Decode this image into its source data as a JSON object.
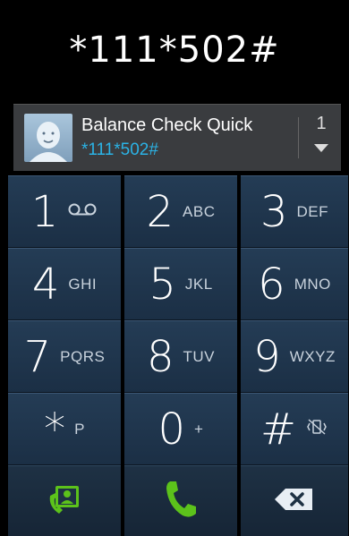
{
  "display": {
    "number": "*111*502#"
  },
  "suggestion": {
    "name": "Balance Check Quick",
    "number": "*111*502#",
    "count": "1"
  },
  "keys": [
    {
      "digit": "1",
      "letters": ""
    },
    {
      "digit": "2",
      "letters": "ABC"
    },
    {
      "digit": "3",
      "letters": "DEF"
    },
    {
      "digit": "4",
      "letters": "GHI"
    },
    {
      "digit": "5",
      "letters": "JKL"
    },
    {
      "digit": "6",
      "letters": "MNO"
    },
    {
      "digit": "7",
      "letters": "PQRS"
    },
    {
      "digit": "8",
      "letters": "TUV"
    },
    {
      "digit": "9",
      "letters": "WXYZ"
    },
    {
      "digit": "*",
      "letters": "P"
    },
    {
      "digit": "0",
      "letters": "+"
    },
    {
      "digit": "#",
      "letters": ""
    }
  ],
  "colors": {
    "accent": "#2bb3e6",
    "key_bg": "#243c55",
    "call_green": "#5cc21b"
  },
  "icons": {
    "voicemail": "voicemail-icon",
    "mute": "vibrate-mute-icon",
    "contacts": "contacts-icon",
    "call": "phone-call-icon",
    "backspace": "backspace-icon"
  }
}
